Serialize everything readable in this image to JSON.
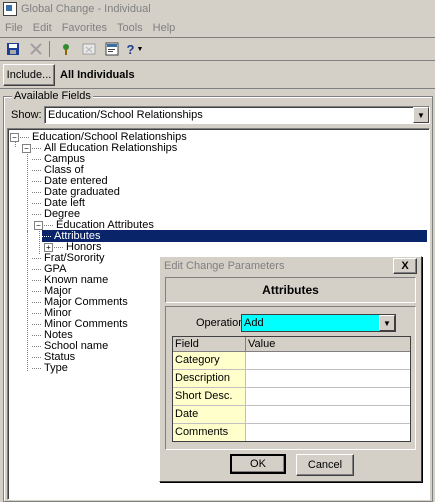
{
  "window": {
    "title": "Global Change - Individual"
  },
  "menu": {
    "items": [
      "File",
      "Edit",
      "Favorites",
      "Tools",
      "Help"
    ]
  },
  "toolbar": {
    "icons": [
      "save-icon",
      "delete-icon",
      "wizard-icon",
      "grid-icon",
      "properties-icon",
      "help-icon"
    ],
    "help_label": "?"
  },
  "include": {
    "button_label": "Include...",
    "selection_label": "All Individuals"
  },
  "available": {
    "group_label": "Available Fields",
    "show_label": "Show:",
    "show_value": "Education/School Relationships"
  },
  "tree": {
    "root": "Education/School Relationships",
    "child": "All Education Relationships",
    "fields": [
      "Campus",
      "Class of",
      "Date entered",
      "Date graduated",
      "Date left",
      "Degree"
    ],
    "attr_group": "Education Attributes",
    "attr_items": [
      "Attributes",
      "Honors"
    ],
    "more_fields": [
      "Frat/Sorority",
      "GPA",
      "Known name",
      "Major",
      "Major Comments",
      "Minor",
      "Minor Comments",
      "Notes",
      "School name",
      "Status",
      "Type"
    ]
  },
  "dialog": {
    "title": "Edit Change Parameters",
    "close_label": "X",
    "header": "Attributes",
    "operation_label": "Operation:",
    "operation_value": "Add",
    "col_field": "Field",
    "col_value": "Value",
    "rows": [
      "Category",
      "Description",
      "Short Desc.",
      "Date",
      "Comments"
    ],
    "ok_label": "OK",
    "cancel_label": "Cancel"
  },
  "colors": {
    "selection": "#0a246a",
    "operation_bg": "#00ffff",
    "field_cell_bg": "#ffffcc"
  }
}
